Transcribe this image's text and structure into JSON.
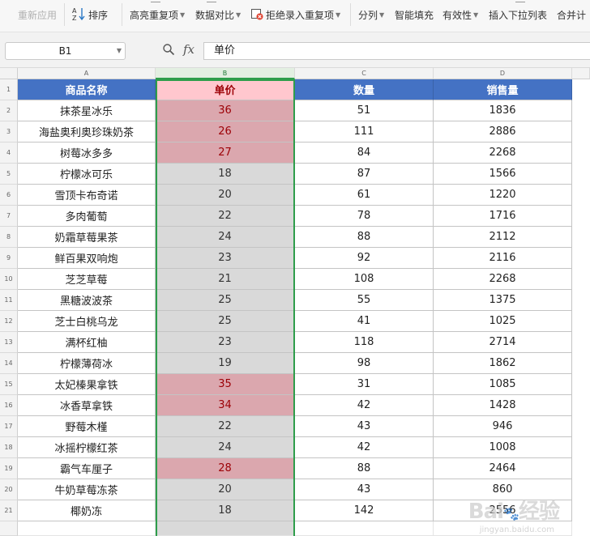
{
  "toolbar": {
    "reapply": "重新应用",
    "sort": "排序",
    "highlight_dup": "高亮重复项",
    "data_compare": "数据对比",
    "reject_dup": "拒绝录入重复项",
    "split": "分列",
    "smart_fill": "智能填充",
    "validity": "有效性",
    "insert_dropdown": "插入下拉列表",
    "merge_calc": "合并计"
  },
  "formula_bar": {
    "name_box": "B1",
    "fx_label": "fx",
    "content": "单价"
  },
  "columns": [
    {
      "letter": "A",
      "header": "商品名称"
    },
    {
      "letter": "B",
      "header": "单价"
    },
    {
      "letter": "C",
      "header": "数量"
    },
    {
      "letter": "D",
      "header": "销售量"
    }
  ],
  "rows": [
    {
      "num": "2",
      "name": "抹茶星冰乐",
      "price": "36",
      "qty": "51",
      "sales": "1836",
      "dup": true
    },
    {
      "num": "3",
      "name": "海盐奥利奥珍珠奶茶",
      "price": "26",
      "qty": "111",
      "sales": "2886",
      "dup": true
    },
    {
      "num": "4",
      "name": "树莓冰多多",
      "price": "27",
      "qty": "84",
      "sales": "2268",
      "dup": true
    },
    {
      "num": "5",
      "name": "柠檬冰可乐",
      "price": "18",
      "qty": "87",
      "sales": "1566",
      "dup": false
    },
    {
      "num": "6",
      "name": "雪顶卡布奇诺",
      "price": "20",
      "qty": "61",
      "sales": "1220",
      "dup": false
    },
    {
      "num": "7",
      "name": "多肉葡萄",
      "price": "22",
      "qty": "78",
      "sales": "1716",
      "dup": false
    },
    {
      "num": "8",
      "name": "奶霜草莓果茶",
      "price": "24",
      "qty": "88",
      "sales": "2112",
      "dup": false
    },
    {
      "num": "9",
      "name": "鲜百果双响炮",
      "price": "23",
      "qty": "92",
      "sales": "2116",
      "dup": false
    },
    {
      "num": "10",
      "name": "芝芝草莓",
      "price": "21",
      "qty": "108",
      "sales": "2268",
      "dup": false
    },
    {
      "num": "11",
      "name": "黑糖波波茶",
      "price": "25",
      "qty": "55",
      "sales": "1375",
      "dup": false
    },
    {
      "num": "12",
      "name": "芝士白桃乌龙",
      "price": "25",
      "qty": "41",
      "sales": "1025",
      "dup": false
    },
    {
      "num": "13",
      "name": "满杯红柚",
      "price": "23",
      "qty": "118",
      "sales": "2714",
      "dup": false
    },
    {
      "num": "14",
      "name": "柠檬薄荷冰",
      "price": "19",
      "qty": "98",
      "sales": "1862",
      "dup": false
    },
    {
      "num": "15",
      "name": "太妃榛果拿铁",
      "price": "35",
      "qty": "31",
      "sales": "1085",
      "dup": true
    },
    {
      "num": "16",
      "name": "冰香草拿铁",
      "price": "34",
      "qty": "42",
      "sales": "1428",
      "dup": true
    },
    {
      "num": "17",
      "name": "野莓木槿",
      "price": "22",
      "qty": "43",
      "sales": "946",
      "dup": false
    },
    {
      "num": "18",
      "name": "冰摇柠檬红茶",
      "price": "24",
      "qty": "42",
      "sales": "1008",
      "dup": false
    },
    {
      "num": "19",
      "name": "霸气车厘子",
      "price": "28",
      "qty": "88",
      "sales": "2464",
      "dup": true
    },
    {
      "num": "20",
      "name": "牛奶草莓冻茶",
      "price": "20",
      "qty": "43",
      "sales": "860",
      "dup": false
    },
    {
      "num": "21",
      "name": "椰奶冻",
      "price": "18",
      "qty": "142",
      "sales": "2556",
      "dup": false
    }
  ],
  "header_row_num": "1",
  "watermark": {
    "brand": "Bai",
    "brand2": "经验",
    "sub": "jingyan.baidu.com"
  },
  "colors": {
    "header_blue": "#4472c4",
    "selection_green": "#2e9d4b",
    "dup_fill": "#dba7ae",
    "dup_text": "#9c0006"
  }
}
